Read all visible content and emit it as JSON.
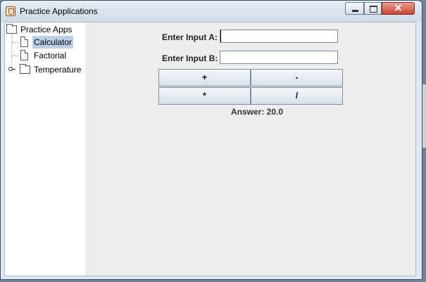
{
  "window": {
    "title": "Practice Applications",
    "close_glyph": "✕"
  },
  "tree": {
    "root": "Practice Apps",
    "items": [
      {
        "label": "Calculator",
        "selected": true
      },
      {
        "label": "Factorial",
        "selected": false
      },
      {
        "label": "Temperature",
        "selected": false
      }
    ]
  },
  "calculator": {
    "input_a_label": "Enter Input A:",
    "input_a_value": "",
    "input_b_label": "Enter Input B:",
    "input_b_value": "",
    "ops": {
      "add": "+",
      "subtract": "-",
      "multiply": "*",
      "divide": "/"
    },
    "answer": "Answer: 20.0"
  },
  "colors": {
    "selection": "#b8cfe5",
    "panel_bg": "#eeeeee",
    "close_button": "#c54434"
  }
}
